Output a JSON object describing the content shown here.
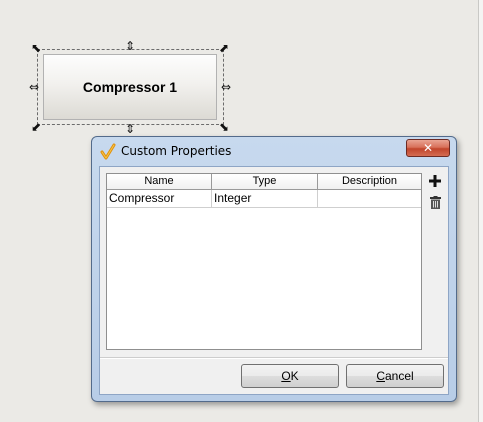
{
  "canvas": {
    "component_label": "Compressor 1"
  },
  "dialog": {
    "title": "Custom Properties",
    "close_icon": "close-x-icon",
    "table": {
      "columns": [
        "Name",
        "Type",
        "Description"
      ],
      "rows": [
        {
          "name": "Compressor",
          "type": "Integer",
          "description": ""
        }
      ]
    },
    "add_icon": "plus-icon",
    "delete_icon": "trash-icon",
    "ok_button": {
      "mnemonic": "O",
      "rest": "K"
    },
    "cancel_button": {
      "mnemonic": "C",
      "rest": "ancel"
    }
  }
}
